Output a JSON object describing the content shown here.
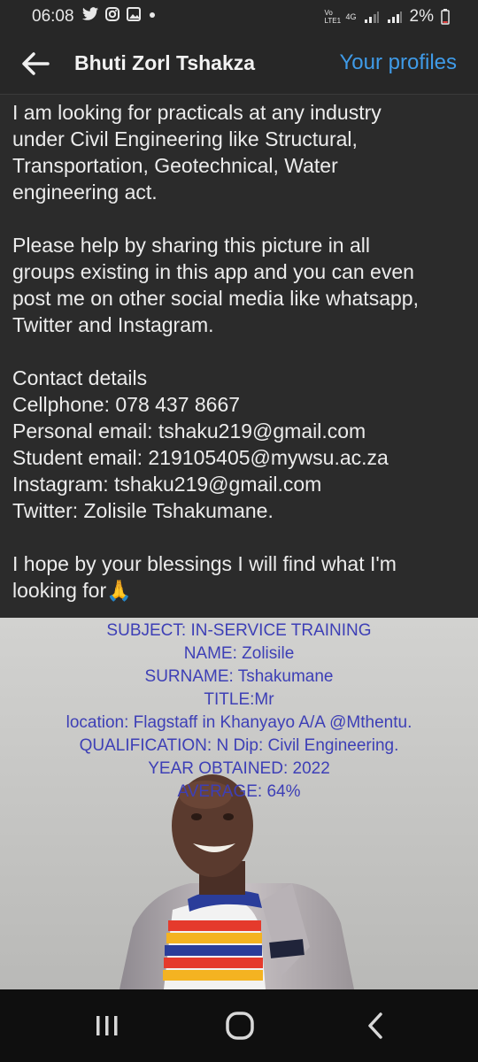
{
  "status": {
    "time": "06:08",
    "network": "4G",
    "volte": "Vo LTE1",
    "battery": "2%"
  },
  "appbar": {
    "title": "Bhuti Zorl Tshakza",
    "profiles_link": "Your profiles"
  },
  "post": {
    "para1": [
      "I am looking for practicals at any industry",
      "under Civil Engineering like Structural,",
      "Transportation, Geotechnical, Water",
      "engineering act."
    ],
    "para2": [
      "Please help by sharing this picture in all",
      "groups existing in this app and you can even",
      "post me on other social media like whatsapp,",
      "Twitter and Instagram."
    ],
    "contact": [
      "Contact details",
      "Cellphone: 078 437 8667",
      "Personal email: tshaku219@gmail.com",
      "Student email: 219105405@mywsu.ac.za",
      "Instagram: tshaku219@gmail.com",
      "Twitter: Zolisile Tshakumane."
    ],
    "closing": [
      "I hope by your blessings I will find what I'm",
      "looking for🙏"
    ]
  },
  "image_text": [
    "SUBJECT: IN-SERVICE TRAINING",
    "NAME: Zolisile",
    "SURNAME: Tshakumane",
    "TITLE:Mr",
    "location: Flagstaff in Khanyayo A/A @Mthentu.",
    "QUALIFICATION: N Dip: Civil Engineering.",
    "YEAR OBTAINED: 2022",
    "AVERAGE: 64%"
  ],
  "icons": {
    "back": "arrow-left-icon",
    "twitter": "twitter-icon",
    "instagram": "instagram-icon",
    "gallery": "gallery-icon",
    "battery": "battery-icon",
    "nav_recents": "recents-icon",
    "nav_home": "home-icon",
    "nav_back": "back-icon"
  },
  "colors": {
    "link": "#3f9be8",
    "image_text": "#3d3fb6",
    "background": "#2b2b2b"
  }
}
